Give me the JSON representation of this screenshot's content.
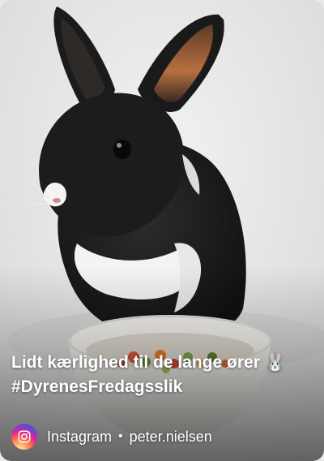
{
  "card": {
    "caption_line1": "Lidt kærlighed til de lange ører 🐰",
    "caption_line2": "#DyrenesFredagsslik",
    "source": "Instagram",
    "separator": "•",
    "author": "peter.nielsen",
    "source_icon": "instagram-icon"
  }
}
